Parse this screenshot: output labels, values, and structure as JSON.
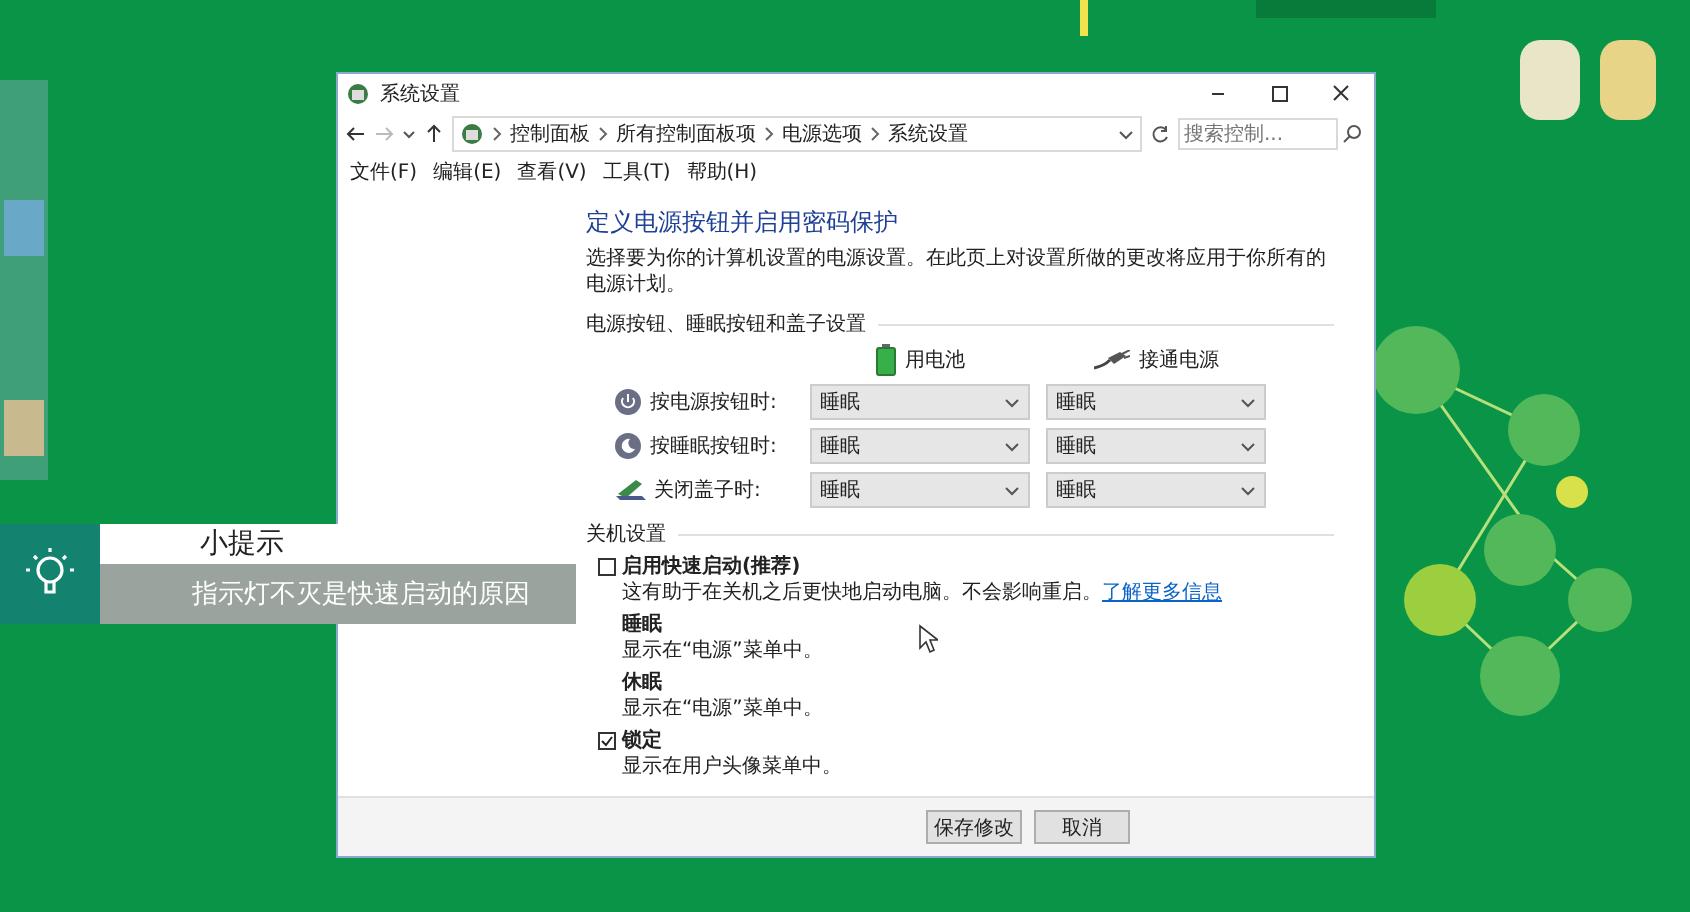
{
  "window": {
    "title": "系统设置"
  },
  "address_bar": {
    "path": [
      "控制面板",
      "所有控制面板项",
      "电源选项",
      "系统设置"
    ]
  },
  "search": {
    "placeholder": "搜索控制..."
  },
  "menu": [
    "文件(F)",
    "编辑(E)",
    "查看(V)",
    "工具(T)",
    "帮助(H)"
  ],
  "content": {
    "heading": "定义电源按钮并启用密码保护",
    "description": "选择要为你的计算机设置的电源设置。在此页上对设置所做的更改将应用于你所有的电源计划。",
    "power_section": {
      "title": "电源按钮、睡眠按钮和盖子设置",
      "columns": [
        {
          "label": "用电池",
          "kind": "battery"
        },
        {
          "label": "接通电源",
          "kind": "plug"
        }
      ],
      "rows": [
        {
          "label": "按电源按钮时:",
          "kind": "power",
          "values": [
            "睡眠",
            "睡眠"
          ]
        },
        {
          "label": "按睡眠按钮时:",
          "kind": "sleep",
          "values": [
            "睡眠",
            "睡眠"
          ]
        },
        {
          "label": "关闭盖子时:",
          "kind": "lid",
          "values": [
            "睡眠",
            "睡眠"
          ]
        }
      ]
    },
    "shutdown_section": {
      "title": "关机设置",
      "options": [
        {
          "label": "启用快速启动(推荐)",
          "description": "这有助于在关机之后更快地启动电脑。不会影响重启。",
          "link": "了解更多信息",
          "checked": false
        },
        {
          "label": "睡眠",
          "description": "显示在“电源”菜单中。"
        },
        {
          "label": "休眠",
          "description": "显示在“电源”菜单中。"
        },
        {
          "label": "锁定",
          "description": "显示在用户头像菜单中。",
          "checked": true
        }
      ]
    }
  },
  "buttons": [
    "保存修改",
    "取消"
  ],
  "tip": {
    "title": "小提示",
    "text": "指示灯不灭是快速启动的原因"
  }
}
